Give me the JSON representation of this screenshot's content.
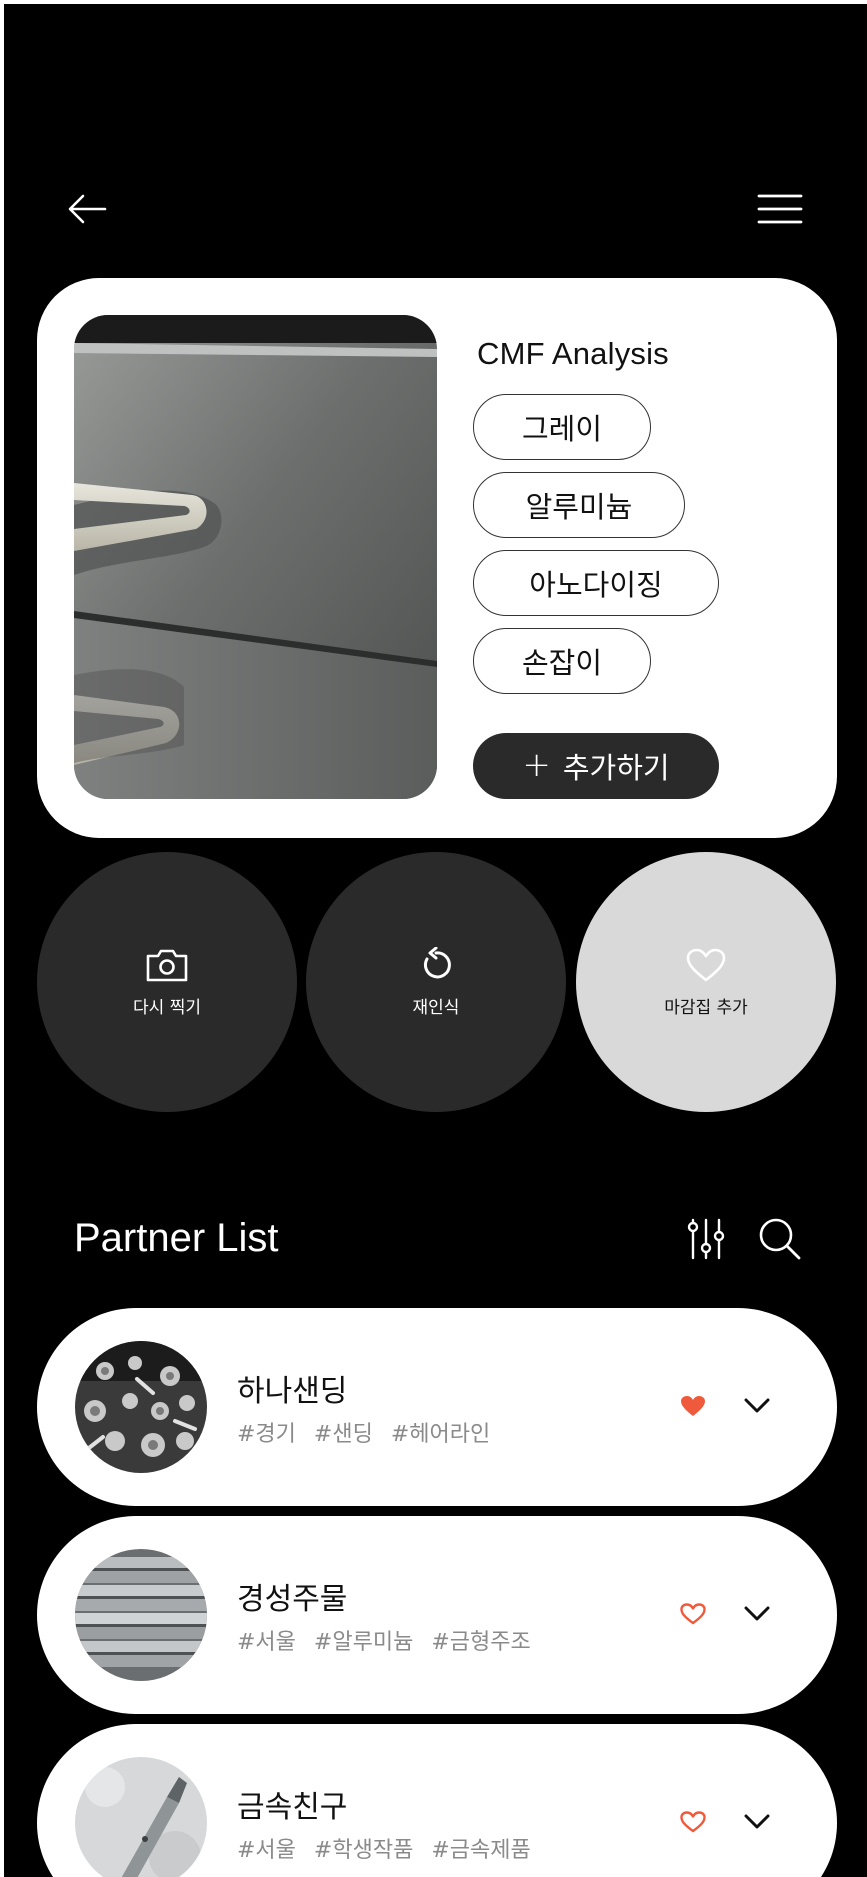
{
  "header": {
    "back_icon": "arrow-left-icon",
    "menu_icon": "hamburger-menu-icon"
  },
  "analysis": {
    "title": "CMF Analysis",
    "tags": [
      "그레이",
      "알루미늄",
      "아노다이징",
      "손잡이"
    ],
    "add_label": "추가하기",
    "add_symbol": "+"
  },
  "actions": [
    {
      "label": "다시 찍기",
      "icon": "camera-icon"
    },
    {
      "label": "재인식",
      "icon": "refresh-icon"
    },
    {
      "label": "마감집 추가",
      "icon": "heart-outline-icon"
    }
  ],
  "partners": {
    "title": "Partner List",
    "items": [
      {
        "name": "하나샌딩",
        "tags": [
          "#경기",
          "#샌딩",
          "#헤어라인"
        ],
        "favorited": true
      },
      {
        "name": "경성주물",
        "tags": [
          "#서울",
          "#알루미늄",
          "#금형주조"
        ],
        "favorited": false
      },
      {
        "name": "금속친구",
        "tags": [
          "#서울",
          "#학생작품",
          "#금속제품"
        ],
        "favorited": false
      }
    ]
  },
  "colors": {
    "background": "#000000",
    "card": "#ffffff",
    "dark_button": "#2a2a2a",
    "light_button": "#d9d9d9",
    "heart": "#f05a3c",
    "tag_text": "#8a8a8a"
  }
}
